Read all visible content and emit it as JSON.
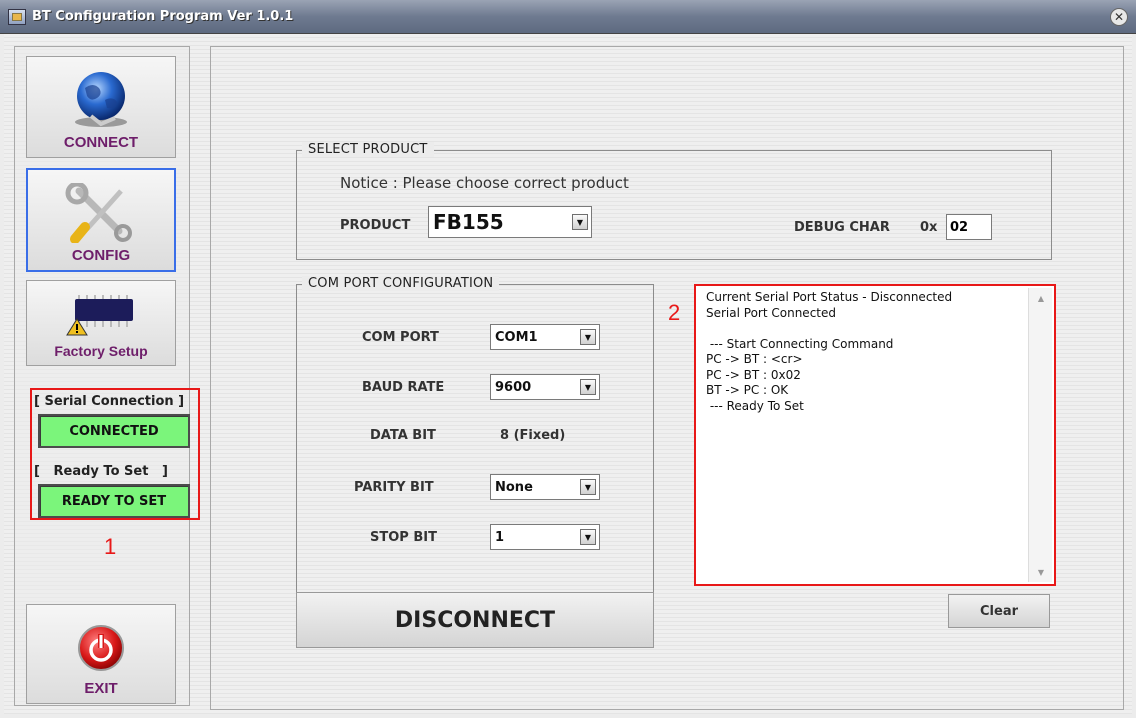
{
  "window": {
    "title": "BT Configuration Program Ver 1.0.1",
    "close_glyph": "✕"
  },
  "sidebar": {
    "connect_label": "CONNECT",
    "config_label": "CONFIG",
    "factory_label": "Factory Setup",
    "exit_label": "EXIT",
    "serial_caption": "[ Serial Connection ]",
    "serial_status": "CONNECTED",
    "ready_caption": "[   Ready To Set   ]",
    "ready_status": "READY TO SET",
    "annotation_1": "1"
  },
  "select_product": {
    "legend": "SELECT PRODUCT",
    "notice": "Notice : Please choose correct product",
    "product_label": "PRODUCT",
    "product_value": "FB155",
    "debug_label": "DEBUG CHAR",
    "debug_prefix": "0x",
    "debug_value": "02"
  },
  "com_config": {
    "legend": "COM PORT CONFIGURATION",
    "com_port_label": "COM PORT",
    "com_port_value": "COM1",
    "baud_label": "BAUD RATE",
    "baud_value": "9600",
    "data_bit_label": "DATA BIT",
    "data_bit_value": "8 (Fixed)",
    "parity_label": "PARITY BIT",
    "parity_value": "None",
    "stop_label": "STOP BIT",
    "stop_value": "1"
  },
  "log": {
    "annotation_2": "2",
    "lines": "Current Serial Port Status - Disconnected\nSerial Port Connected\n\n --- Start Connecting Command\nPC -> BT : <cr>\nPC -> BT : 0x02\nBT -> PC : OK\n --- Ready To Set"
  },
  "buttons": {
    "disconnect": "DISCONNECT",
    "clear": "Clear"
  },
  "colors": {
    "status_green": "#7bf57b",
    "annotation_red": "#e81818",
    "active_border": "#3a6ee8"
  }
}
